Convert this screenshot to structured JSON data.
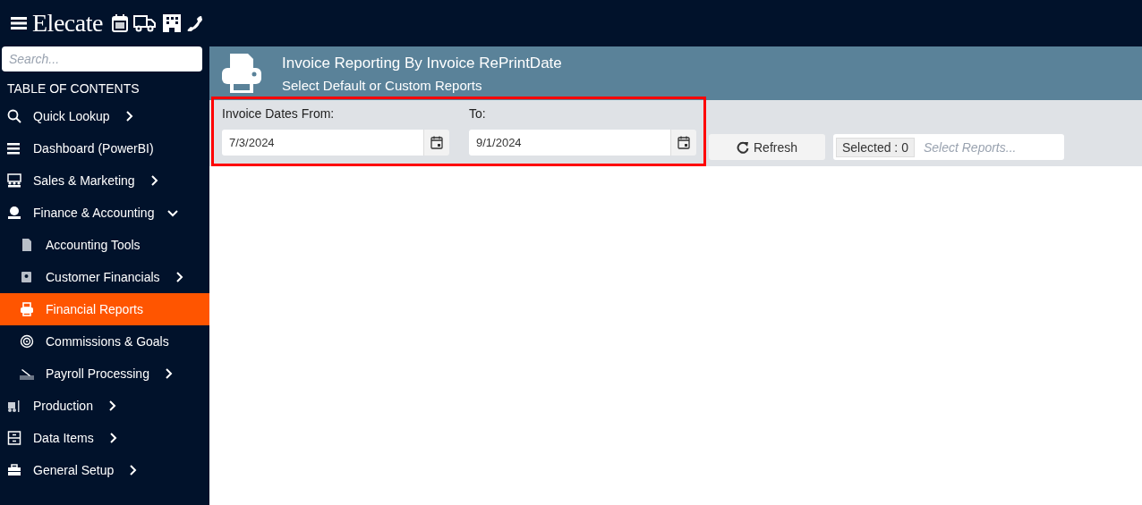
{
  "topbar": {
    "logo": "Elecate"
  },
  "sidebar": {
    "search": {
      "placeholder": "Search..."
    },
    "heading": "TABLE OF CONTENTS",
    "items": [
      {
        "label": "Quick Lookup",
        "selected": false,
        "expanded": false
      },
      {
        "label": "Dashboard (PowerBI)",
        "selected": false
      },
      {
        "label": "Sales & Marketing",
        "selected": false,
        "expanded": false
      },
      {
        "label": "Finance & Accounting",
        "selected": false,
        "expanded": true,
        "children": [
          {
            "label": "Accounting Tools",
            "selected": false
          },
          {
            "label": "Customer Financials",
            "selected": false,
            "expanded": false
          },
          {
            "label": "Financial Reports",
            "selected": true
          },
          {
            "label": "Commissions & Goals",
            "selected": false
          },
          {
            "label": "Payroll Processing",
            "selected": false,
            "expanded": false
          }
        ]
      },
      {
        "label": "Production",
        "selected": false,
        "expanded": false
      },
      {
        "label": "Data Items",
        "selected": false,
        "expanded": false
      },
      {
        "label": "General Setup",
        "selected": false,
        "expanded": false
      }
    ]
  },
  "header": {
    "title": "Invoice Reporting By Invoice RePrintDate",
    "subtitle": "Select Default or Custom Reports"
  },
  "filters": {
    "highlighted": true,
    "from_label": "Invoice Dates From:",
    "from_value": "7/3/2024",
    "to_label": "To:",
    "to_value": "9/1/2024",
    "refresh_button": "Refresh",
    "selected_count": "Selected : 0",
    "reports_placeholder": "Select Reports..."
  }
}
